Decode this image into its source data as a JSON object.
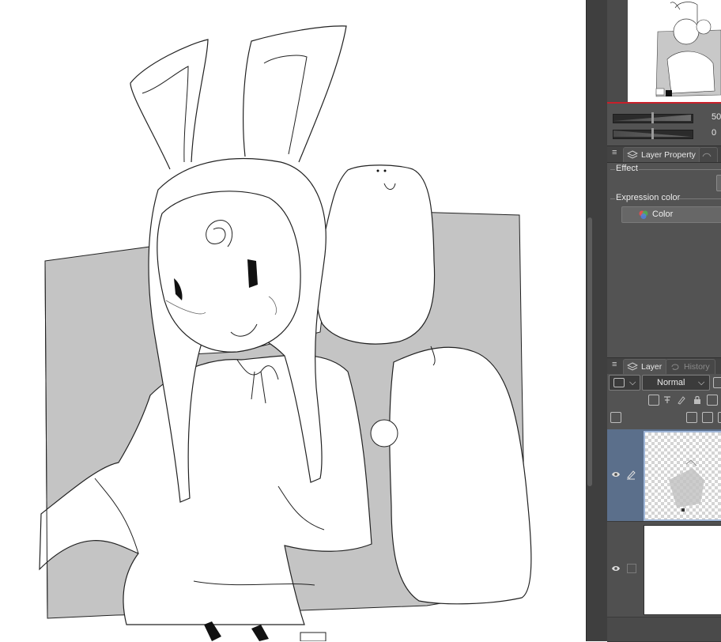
{
  "navigator": {
    "zoom_value": "50",
    "rotation_value": "0"
  },
  "property_panel": {
    "menu_glyph": "≡",
    "tab_active_label": "Layer Property",
    "effect_label": "Effect",
    "expression_color_label": "Expression color",
    "color_button_label": "Color"
  },
  "layer_panel": {
    "menu_glyph": "≡",
    "tab_active_label": "Layer",
    "tab_inactive_label": "History",
    "blend_mode": "Normal"
  },
  "icons": {
    "layer_tab": "layers-icon",
    "history_tab": "history-icon",
    "visibility": "eye-icon",
    "edit": "pencil-icon",
    "color_wheel": "color-circles-icon"
  },
  "colors": {
    "panel_bg": "#535353",
    "tab_bar_bg": "#434343",
    "selection_blue": "#5b6f8b",
    "accent_red": "#c8202a",
    "canvas_gray_fill": "#c4c4c4"
  }
}
